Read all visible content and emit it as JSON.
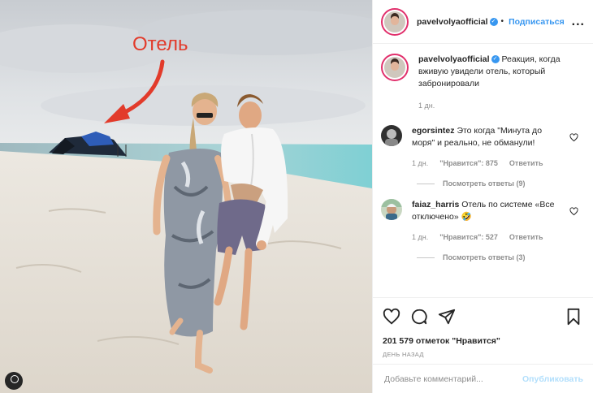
{
  "post": {
    "author": "pavelvolyaofficial",
    "follow_label": "Подписаться",
    "dot": "•",
    "more": "..."
  },
  "photo": {
    "annotation": "Отель",
    "arrow_color": "#e23b2b"
  },
  "caption": {
    "author": "pavelvolyaofficial",
    "text": "Реакция, когда вживую увидели отель, который забронировали",
    "time": "1 дн."
  },
  "comments": [
    {
      "author": "egorsintez",
      "text": "Это когда \"Минута до моря\" и реально, не обманули!",
      "time": "1 дн.",
      "likes": "\"Нравится\": 875",
      "reply": "Ответить",
      "view_replies": "Посмотреть ответы (9)"
    },
    {
      "author": "faiaz_harris",
      "text": "Отель по системе «Все отключено» 🤣",
      "time": "1 дн.",
      "likes": "\"Нравится\": 527",
      "reply": "Ответить",
      "view_replies": "Посмотреть ответы (3)"
    }
  ],
  "stats": {
    "likes": "201 579 отметок \"Нравится\"",
    "ago": "ДЕНЬ НАЗАД"
  },
  "composer": {
    "placeholder": "Добавьте комментарий...",
    "publish_label": "Опубликовать"
  },
  "colors": {
    "accent": "#3897f0",
    "muted": "#8e8e8e",
    "publish_disabled": "#b2dffc"
  },
  "icons": [
    "heart-icon",
    "comment-icon",
    "share-icon",
    "bookmark-icon",
    "more-icon",
    "verified-icon",
    "instagram-badge-icon"
  ]
}
